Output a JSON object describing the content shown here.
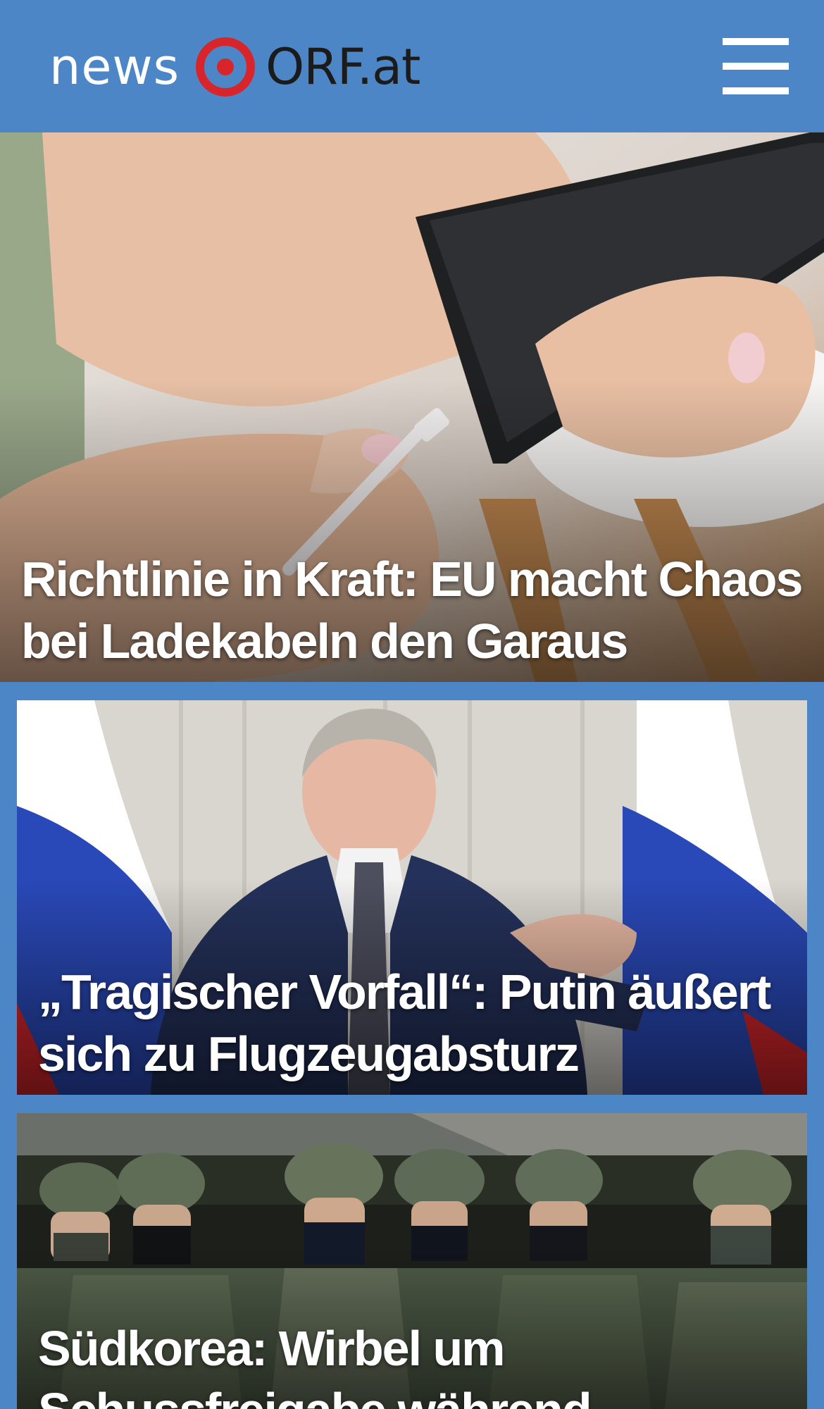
{
  "header": {
    "logo_news": "news",
    "logo_orf": "ORF.at",
    "brand_red": "#d8252b",
    "bar_color": "#4d86c6",
    "menu_icon": "hamburger-menu-icon"
  },
  "articles": [
    {
      "headline": "Richtlinie in Kraft: EU macht Chaos bei Ladekabeln den Garaus"
    },
    {
      "headline": "„Tragischer Vorfall“: Putin äußert sich zu Flugzeugabsturz"
    },
    {
      "headline": "Südkorea: Wirbel um Schussfreigabe während"
    }
  ]
}
